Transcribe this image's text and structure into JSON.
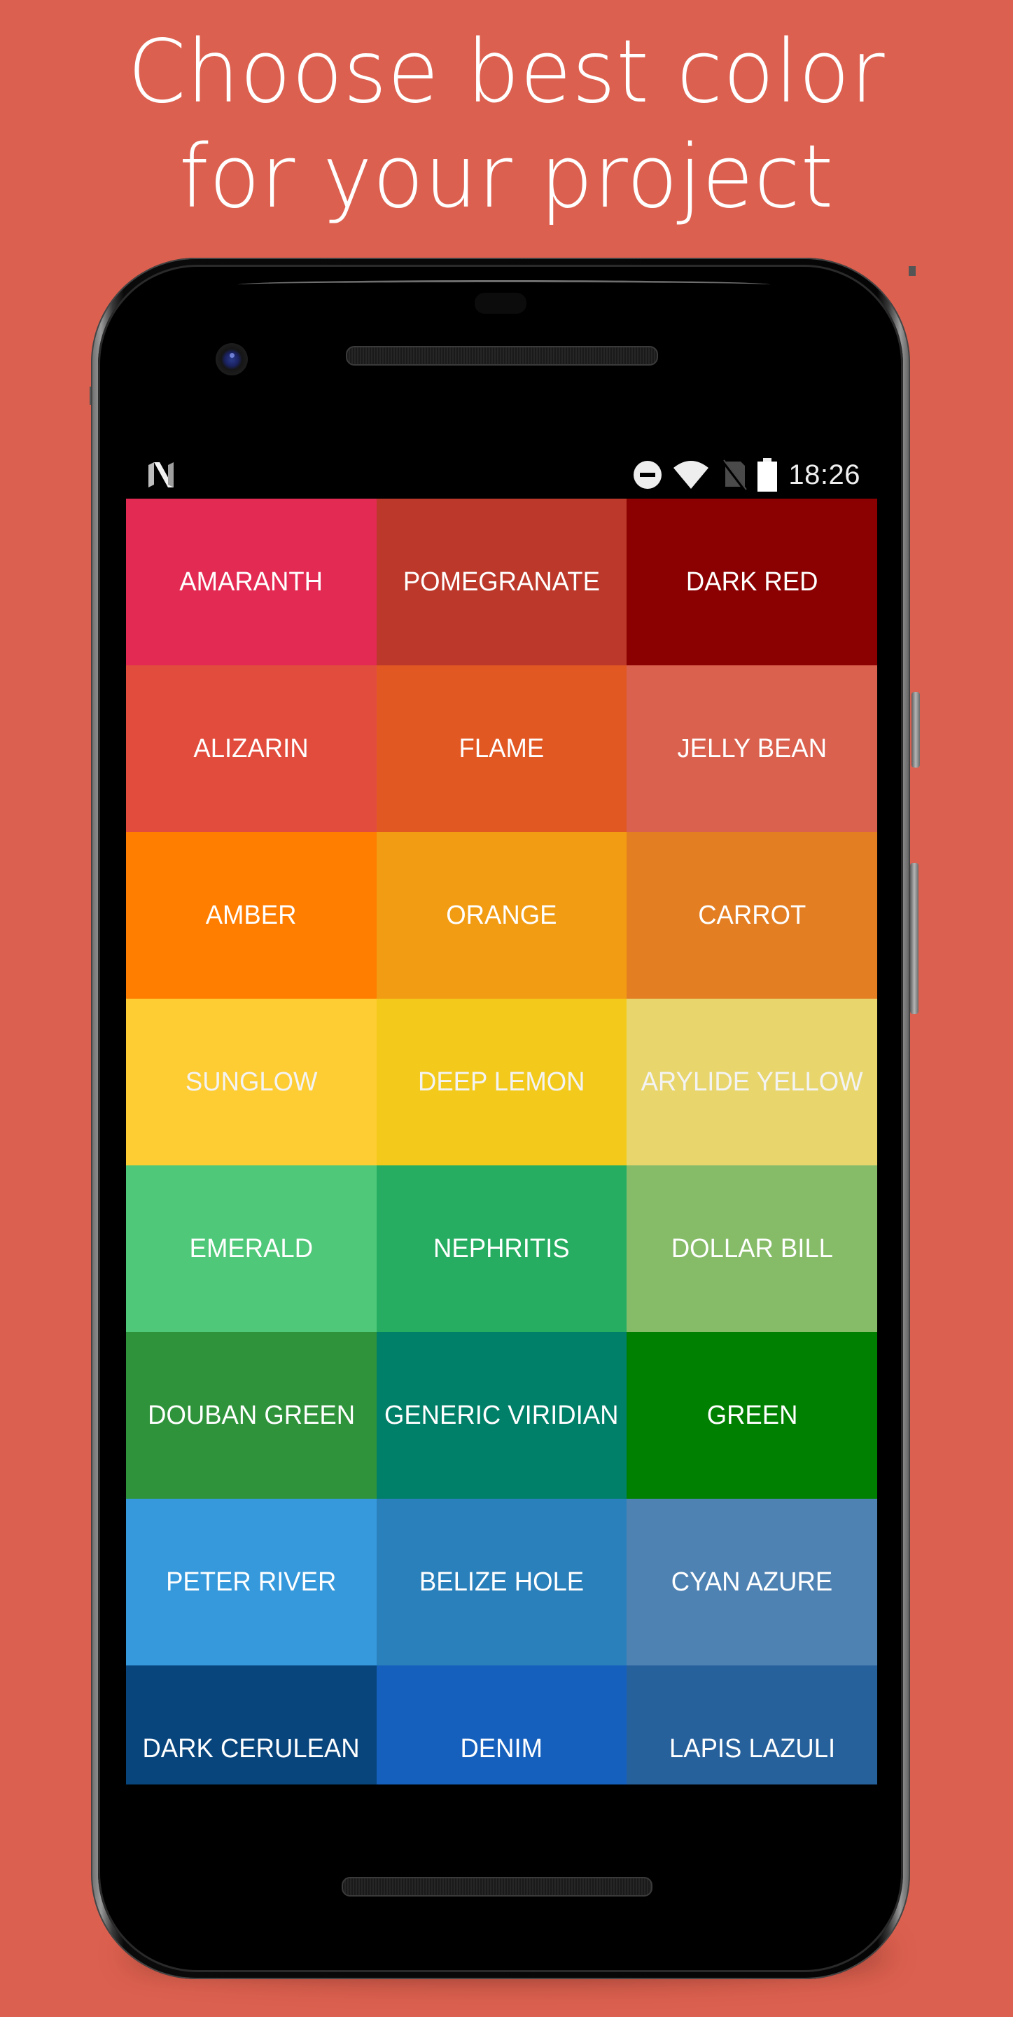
{
  "headline": {
    "line1": "Choose best color",
    "line2": "for your project"
  },
  "background_color": "#DC604F",
  "status_bar": {
    "left_icon": "android-n-logo-icon",
    "icons": [
      "do-not-disturb-icon",
      "wifi-icon",
      "no-sim-icon",
      "battery-full-icon"
    ],
    "time": "18:26"
  },
  "colors": [
    [
      {
        "name": "AMARANTH",
        "hex": "#E32A53"
      },
      {
        "name": "POMEGRANATE",
        "hex": "#BC382B"
      },
      {
        "name": "DARK RED",
        "hex": "#8B0000"
      }
    ],
    [
      {
        "name": "ALIZARIN",
        "hex": "#E24C3D"
      },
      {
        "name": "FLAME",
        "hex": "#E15823"
      },
      {
        "name": "JELLY BEAN",
        "hex": "#DA614E"
      }
    ],
    [
      {
        "name": "AMBER",
        "hex": "#FF7E00"
      },
      {
        "name": "ORANGE",
        "hex": "#F29C13"
      },
      {
        "name": "CARROT",
        "hex": "#E37E22"
      }
    ],
    [
      {
        "name": "SUNGLOW",
        "hex": "#FECC33"
      },
      {
        "name": "DEEP LEMON",
        "hex": "#F3CA1B"
      },
      {
        "name": "ARYLIDE YELLOW",
        "hex": "#E8D66D"
      }
    ],
    [
      {
        "name": "EMERALD",
        "hex": "#50C879"
      },
      {
        "name": "NEPHRITIS",
        "hex": "#27AD61"
      },
      {
        "name": "DOLLAR BILL",
        "hex": "#86BB68"
      }
    ],
    [
      {
        "name": "DOUBAN GREEN",
        "hex": "#2F933B"
      },
      {
        "name": "GENERIC VIRIDIAN",
        "hex": "#007F69"
      },
      {
        "name": "GREEN",
        "hex": "#008000"
      }
    ],
    [
      {
        "name": "PETER RIVER",
        "hex": "#3599DC"
      },
      {
        "name": "BELIZE HOLE",
        "hex": "#2A80BB"
      },
      {
        "name": "CYAN AZURE",
        "hex": "#4E82B3"
      }
    ],
    [
      {
        "name": "DARK CERULEAN",
        "hex": "#08457D"
      },
      {
        "name": "DENIM",
        "hex": "#1560BD"
      },
      {
        "name": "LAPIS LAZULI",
        "hex": "#26619C"
      }
    ]
  ]
}
